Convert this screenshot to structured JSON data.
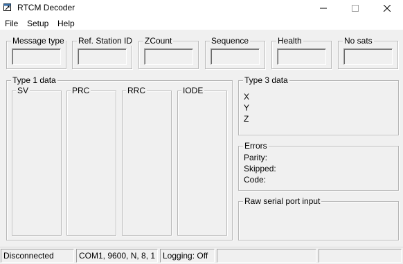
{
  "window": {
    "title": "RTCM Decoder"
  },
  "menu": {
    "file": "File",
    "setup": "Setup",
    "help": "Help"
  },
  "header_fields": {
    "message_type": "Message type",
    "ref_station_id": "Ref. Station ID",
    "zcount": "ZCount",
    "sequence": "Sequence",
    "health": "Health",
    "no_sats": "No sats"
  },
  "type1": {
    "title": "Type 1 data",
    "columns": [
      "SV",
      "PRC",
      "RRC",
      "IODE"
    ]
  },
  "type3": {
    "title": "Type 3 data",
    "labels": [
      "X",
      "Y",
      "Z"
    ]
  },
  "errors": {
    "title": "Errors",
    "labels": [
      "Parity:",
      "Skipped:",
      "Code:"
    ]
  },
  "raw": {
    "title": "Raw serial port input"
  },
  "status": {
    "connection": "Disconnected",
    "port_settings": "COM1, 9600, N, 8, 1",
    "logging": "Logging: Off"
  },
  "icons": [
    "app-icon",
    "minimize-icon",
    "maximize-icon",
    "close-icon"
  ]
}
